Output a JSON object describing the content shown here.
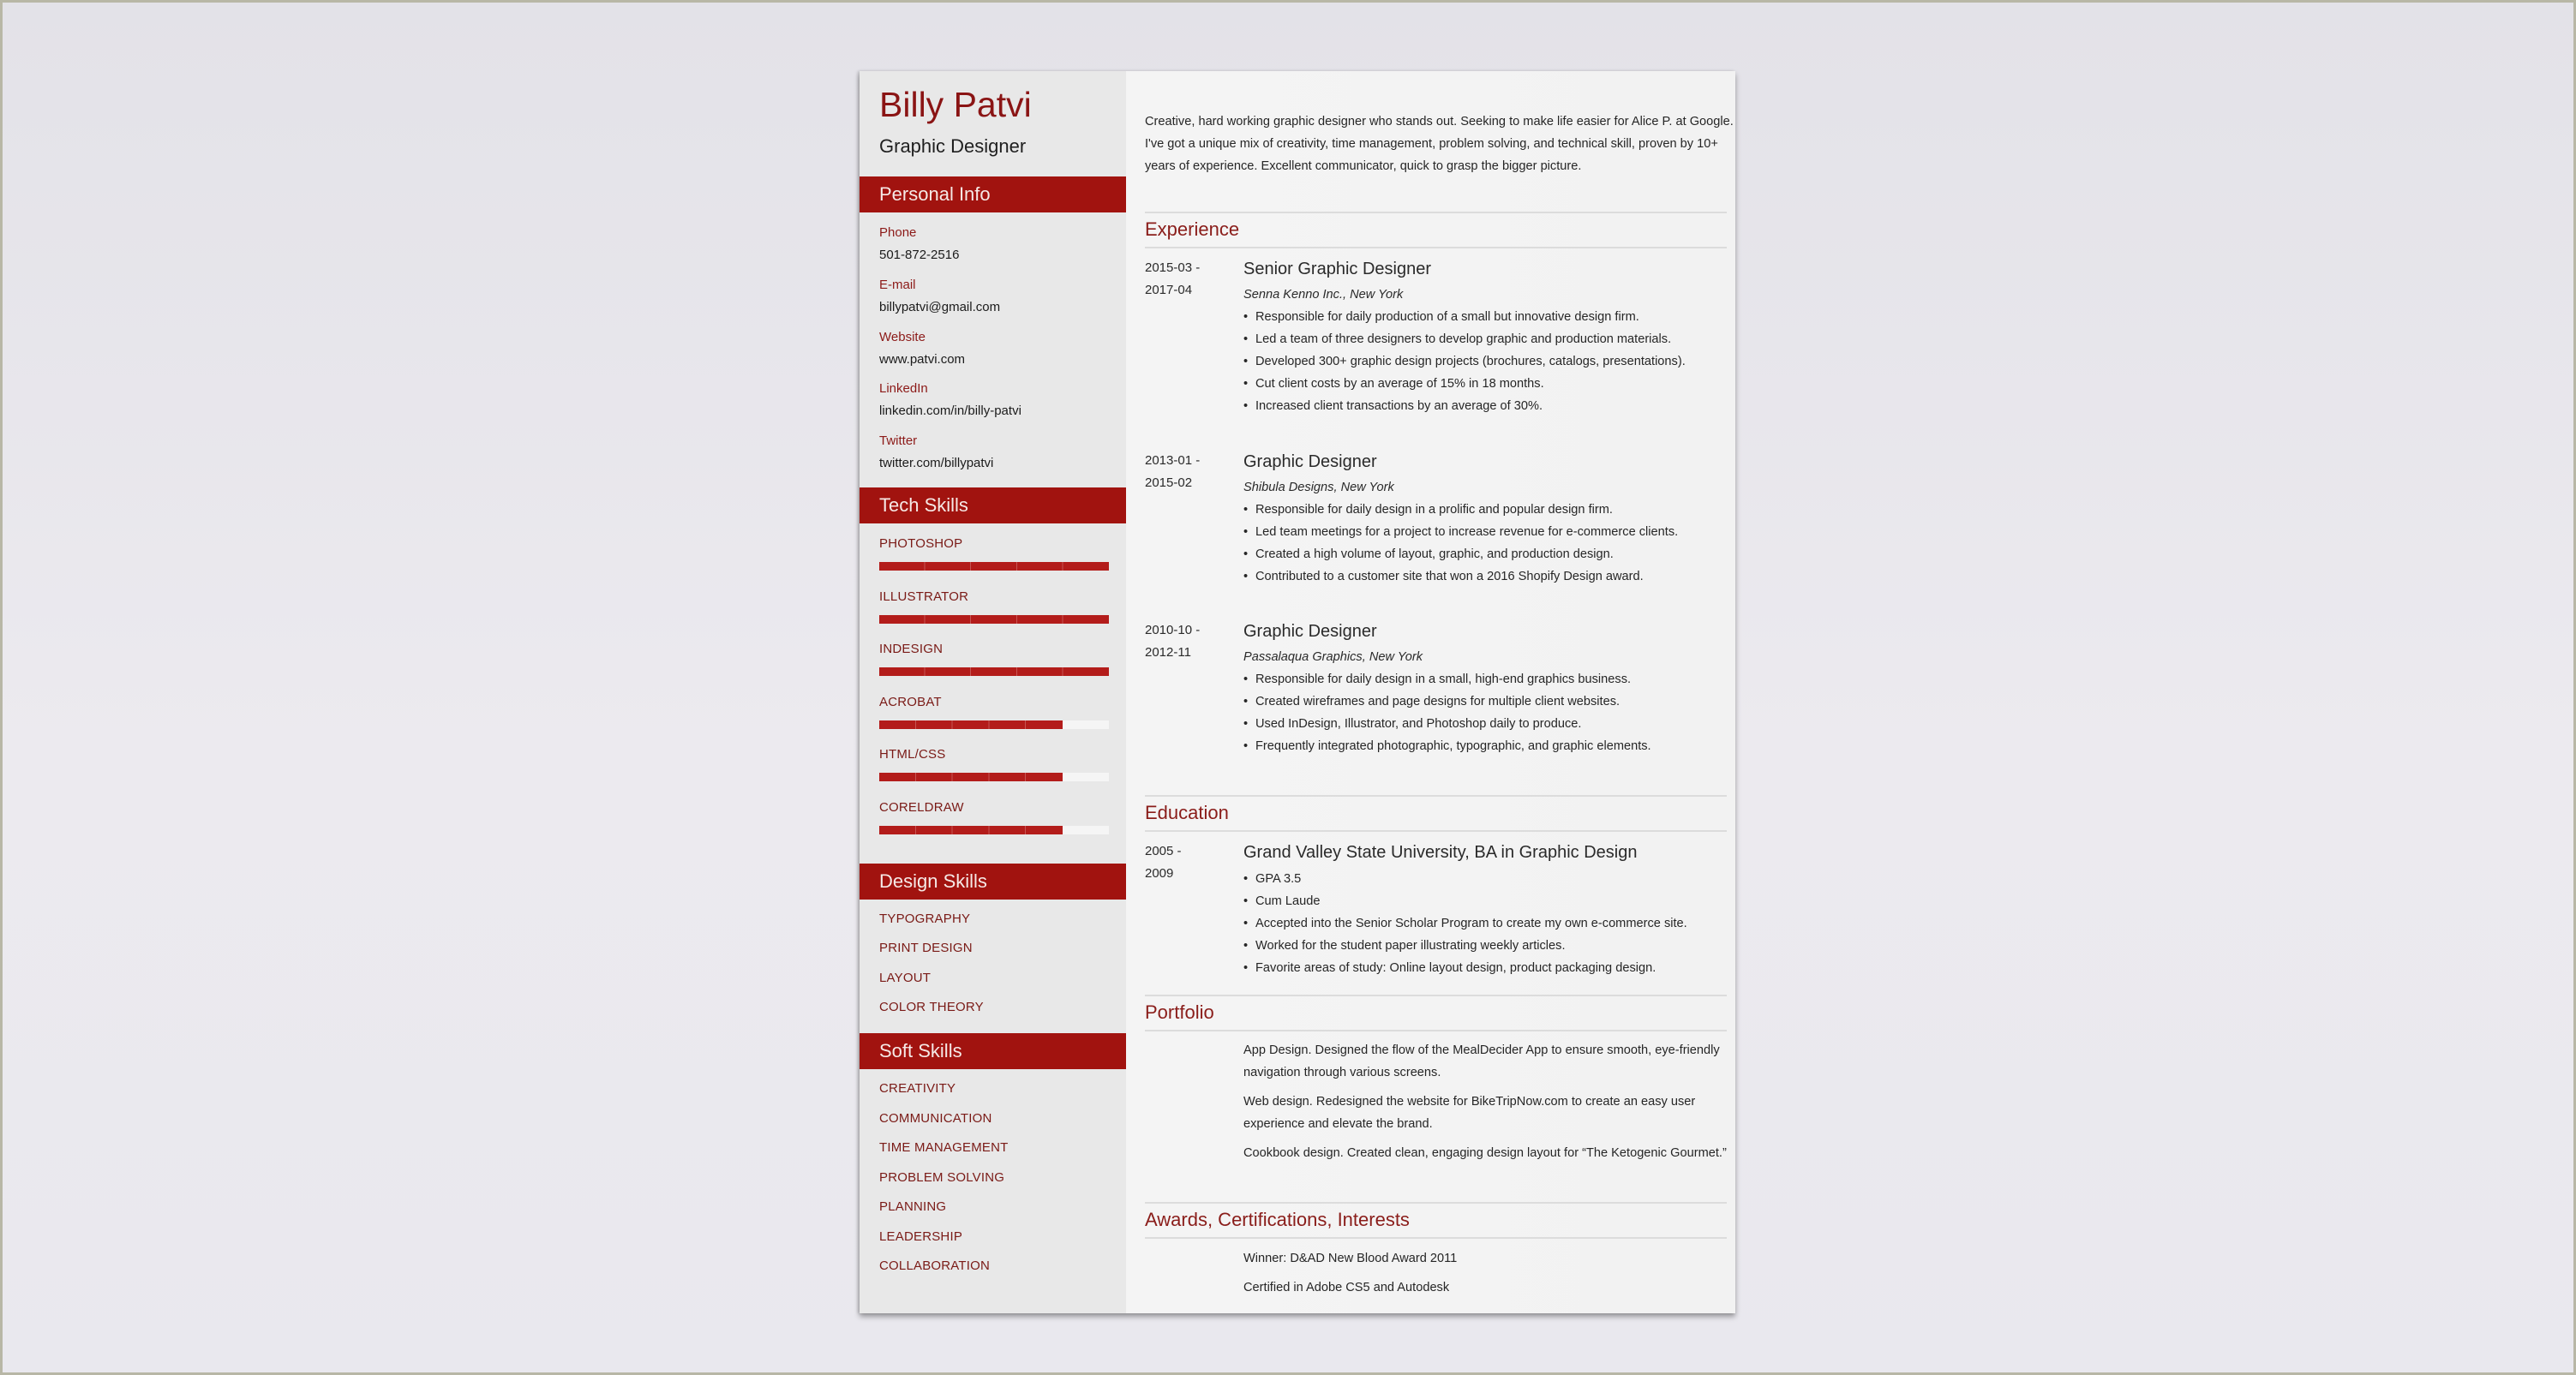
{
  "header": {
    "name": "Billy Patvi",
    "title": "Graphic Designer"
  },
  "colors": {
    "accent": "#a1130f",
    "name_color": "#8a1414",
    "bar_fill": "#b31c1a"
  },
  "personal_info": {
    "heading": "Personal Info",
    "items": [
      {
        "label": "Phone",
        "value": "501-872-2516"
      },
      {
        "label": "E-mail",
        "value": "billypatvi@gmail.com"
      },
      {
        "label": "Website",
        "value": "www.patvi.com"
      },
      {
        "label": "LinkedIn",
        "value": "linkedin.com/in/billy-patvi"
      },
      {
        "label": "Twitter",
        "value": "twitter.com/billypatvi"
      }
    ]
  },
  "tech_skills": {
    "heading": "Tech Skills",
    "items": [
      {
        "name": "PHOTOSHOP",
        "level": 1.0
      },
      {
        "name": "ILLUSTRATOR",
        "level": 1.0
      },
      {
        "name": "INDESIGN",
        "level": 1.0
      },
      {
        "name": "ACROBAT",
        "level": 0.8
      },
      {
        "name": "HTML/CSS",
        "level": 0.8
      },
      {
        "name": "CORELDRAW",
        "level": 0.8
      }
    ]
  },
  "design_skills": {
    "heading": "Design Skills",
    "items": [
      "TYPOGRAPHY",
      "PRINT DESIGN",
      "LAYOUT",
      "COLOR THEORY"
    ]
  },
  "soft_skills": {
    "heading": "Soft Skills",
    "items": [
      "CREATIVITY",
      "COMMUNICATION",
      "TIME MANAGEMENT",
      "PROBLEM SOLVING",
      "PLANNING",
      "LEADERSHIP",
      "COLLABORATION"
    ]
  },
  "summary": "Creative, hard working graphic designer who stands out. Seeking to make life easier for Alice P. at Google. I've got a unique mix of creativity, time management, problem solving, and technical skill, proven by 10+ years of experience. Excellent communicator, quick to grasp the bigger picture.",
  "experience": {
    "heading": "Experience",
    "jobs": [
      {
        "date_start": "2015-03 -",
        "date_end": "2017-04",
        "title": "Senior Graphic Designer",
        "company": "Senna Kenno Inc., New York",
        "bullets": [
          "Responsible for daily production of a small but innovative design firm.",
          "Led a team of three designers to develop graphic and production materials.",
          "Developed 300+ graphic design projects (brochures, catalogs, presentations).",
          "Cut client costs by an average of 15% in 18 months.",
          "Increased client transactions by an average of 30%."
        ]
      },
      {
        "date_start": "2013-01 -",
        "date_end": "2015-02",
        "title": "Graphic Designer",
        "company": "Shibula Designs, New York",
        "bullets": [
          "Responsible for daily design in a prolific and popular design firm.",
          "Led team meetings for a project to increase revenue for e-commerce clients.",
          "Created a high volume of layout, graphic, and production design.",
          "Contributed to a customer site that won a 2016 Shopify Design award."
        ]
      },
      {
        "date_start": "2010-10 -",
        "date_end": "2012-11",
        "title": "Graphic Designer",
        "company": "Passalaqua Graphics, New York",
        "bullets": [
          "Responsible for daily design in a small, high-end graphics business.",
          "Created wireframes and page designs for multiple client websites.",
          "Used InDesign, Illustrator, and Photoshop daily to produce.",
          "Frequently integrated photographic, typographic, and graphic elements."
        ]
      }
    ]
  },
  "education": {
    "heading": "Education",
    "date_start": "2005 -",
    "date_end": "2009",
    "degree": "Grand Valley State University, BA in Graphic Design",
    "bullets": [
      "GPA 3.5",
      "Cum Laude",
      "Accepted into the Senior Scholar Program to create my own e-commerce site.",
      "Worked for the student paper illustrating weekly articles.",
      "Favorite areas of study: Online layout design, product packaging design."
    ]
  },
  "portfolio": {
    "heading": "Portfolio",
    "items": [
      "App Design. Designed the flow of the MealDecider App to ensure smooth, eye-friendly navigation through various screens.",
      "Web design. Redesigned the website for BikeTripNow.com to create an easy user experience and elevate the brand.",
      "Cookbook design. Created clean, engaging design layout for “The Ketogenic Gourmet.”"
    ]
  },
  "awards": {
    "heading": "Awards, Certifications, Interests",
    "items": [
      "Winner: D&AD New Blood Award 2011",
      "Certified in Adobe CS5 and Autodesk"
    ]
  }
}
